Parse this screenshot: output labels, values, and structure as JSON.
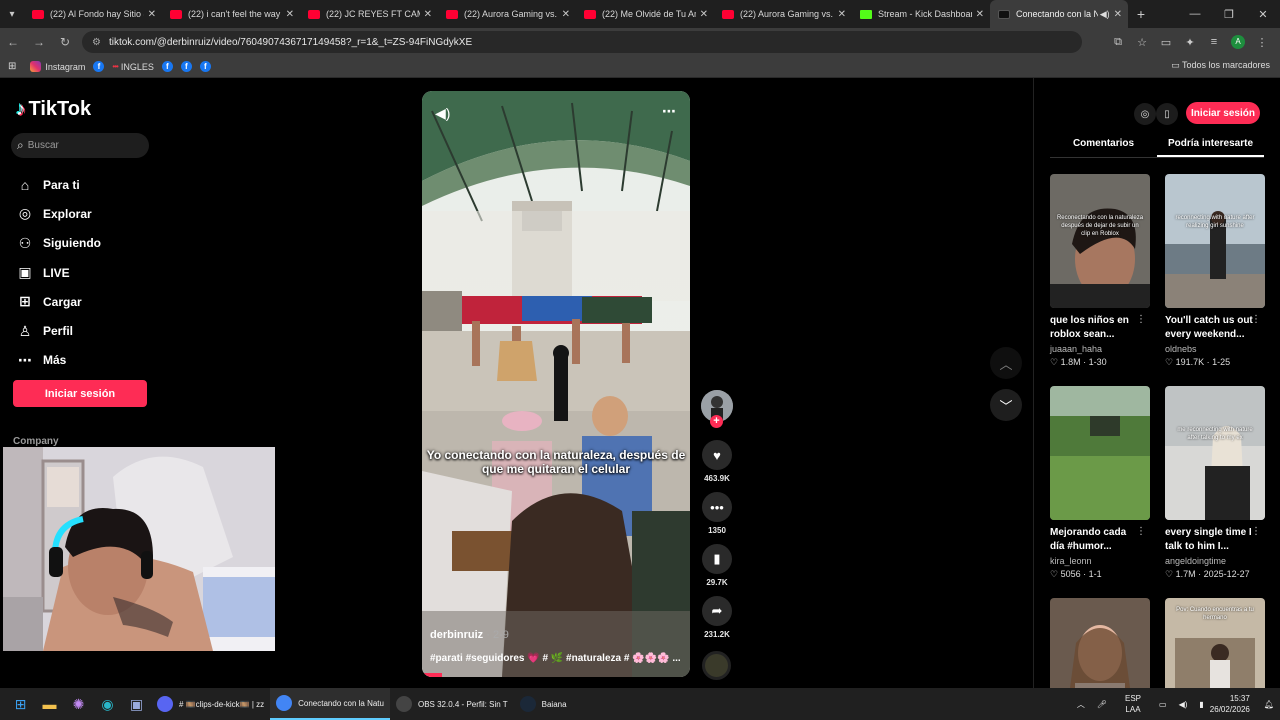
{
  "browser": {
    "tabs": [
      {
        "title": "(22) Al Fondo hay Sitio 8:",
        "type": "yt"
      },
      {
        "title": "(22) i can't feel the way i",
        "type": "yt"
      },
      {
        "title": "(22) JC REYES FT CAMIN",
        "type": "yt"
      },
      {
        "title": "(22) Aurora Gaming vs. X",
        "type": "yt"
      },
      {
        "title": "(22) Me Olvidé de Tu Am",
        "type": "yt"
      },
      {
        "title": "(22) Aurora Gaming vs. X",
        "type": "yt"
      },
      {
        "title": "Stream - Kick Dashboard",
        "type": "kick"
      },
      {
        "title": "Conectando con la N",
        "type": "tt",
        "active": true
      }
    ],
    "url": "tiktok.com/@derbinruiz/video/7604907436717149458?_r=1&_t=ZS-94FiNGdykXE",
    "profile_initial": "A",
    "bookmarks": {
      "instagram": "Instagram",
      "ingles": "INGLES",
      "all": "Todos los marcadores",
      "fb_glyph": "f"
    }
  },
  "tiktok": {
    "logo": "TikTok",
    "search_placeholder": "Buscar",
    "nav": [
      {
        "label": "Para ti",
        "icon": "home-icon"
      },
      {
        "label": "Explorar",
        "icon": "compass-icon"
      },
      {
        "label": "Siguiendo",
        "icon": "following-icon"
      },
      {
        "label": "LIVE",
        "icon": "live-icon"
      },
      {
        "label": "Cargar",
        "icon": "upload-icon"
      },
      {
        "label": "Perfil",
        "icon": "profile-icon"
      },
      {
        "label": "Más",
        "icon": "more-icon"
      }
    ],
    "login_button": "Iniciar sesión",
    "company": "Company",
    "video": {
      "caption": "Yo conectando con la naturaleza, después de que me quitaran el celular",
      "author": "derbinruiz",
      "age": " · 2-9",
      "tags": "#parati #seguidores 💗 # 🌿 #naturaleza # 🌸🌸🌸 ..."
    },
    "actions": {
      "likes": "463.9K",
      "comments": "1350",
      "saves": "29.7K",
      "shares": "231.2K",
      "follow_plus": "+"
    },
    "right_panel": {
      "login_button": "Iniciar sesión",
      "tabs": [
        "Comentarios",
        "Podría interesarte"
      ],
      "cards": [
        {
          "title": "que los niños en roblox sean...",
          "user": "juaaan_haha",
          "likes": "1.8M",
          "date": "1-30",
          "thumb_text": "Reconectando con la naturaleza después de dejar de subir un clip en Roblox"
        },
        {
          "title": "You'll catch us out every weekend...",
          "user": "oldnebs",
          "likes": "191.7K",
          "date": "1-25",
          "thumb_text": "reconnecting with nature after realizing girl sunshine"
        },
        {
          "title": "Mejorando cada día #humor...",
          "user": "kira_leonn",
          "likes": "5056",
          "date": "1-1",
          "thumb_text": ""
        },
        {
          "title": "every single time I talk to him I...",
          "user": "angeldoingtime",
          "likes": "1.7M",
          "date": "2025-12-27",
          "thumb_text": "me reconnecting with nature after talking to my ex"
        },
        {
          "title": "",
          "user": "",
          "likes": "",
          "date": "",
          "thumb_text": ""
        },
        {
          "title": "",
          "user": "",
          "likes": "",
          "date": "",
          "thumb_text": "Pov: Cuando encuentras a tu hermano"
        }
      ]
    }
  },
  "taskbar": {
    "apps": [
      {
        "label": "# 🎞️clips-de-kick🎞️ | zz",
        "icon": "discord-icon",
        "color": "#5865f2"
      },
      {
        "label": "Conectando con la Natu",
        "icon": "chrome-icon",
        "color": "#4285f4",
        "active": true
      },
      {
        "label": "OBS 32.0.4 - Perfil: Sin T",
        "icon": "obs-icon",
        "color": "#444"
      },
      {
        "label": "Baiana",
        "icon": "steam-icon",
        "color": "#1b2838"
      }
    ],
    "lang_top": "ESP",
    "lang_bottom": "LAA",
    "time": "15:37",
    "date": "26/02/2026"
  }
}
